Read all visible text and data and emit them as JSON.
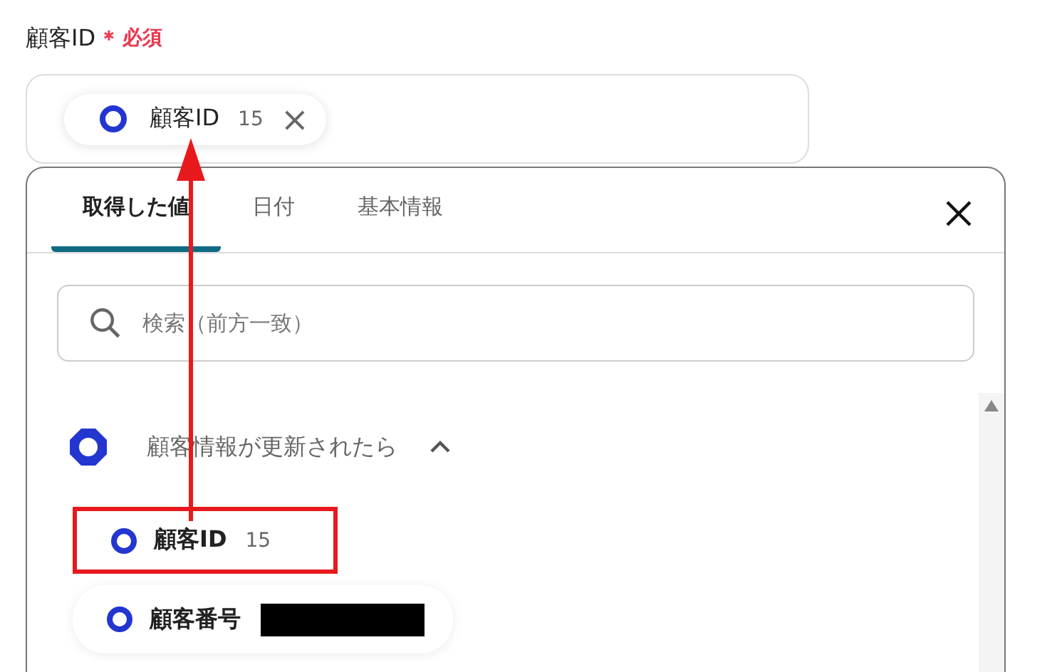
{
  "field": {
    "label": "顧客ID",
    "required_mark": "＊",
    "required_text": "必須",
    "chip": {
      "label": "顧客ID",
      "count": "15",
      "close": "×"
    }
  },
  "panel": {
    "tabs": [
      {
        "label": "取得した値",
        "selected": true
      },
      {
        "label": "日付",
        "selected": false
      },
      {
        "label": "基本情報",
        "selected": false
      }
    ],
    "search": {
      "placeholder": "検索（前方一致）"
    },
    "group": {
      "title": "顧客情報が更新されたら",
      "expanded": true,
      "items": [
        {
          "label": "顧客ID",
          "value": "15",
          "redacted": false,
          "highlighted": true
        },
        {
          "label": "顧客番号",
          "redacted": true,
          "highlighted": false
        }
      ]
    }
  }
}
